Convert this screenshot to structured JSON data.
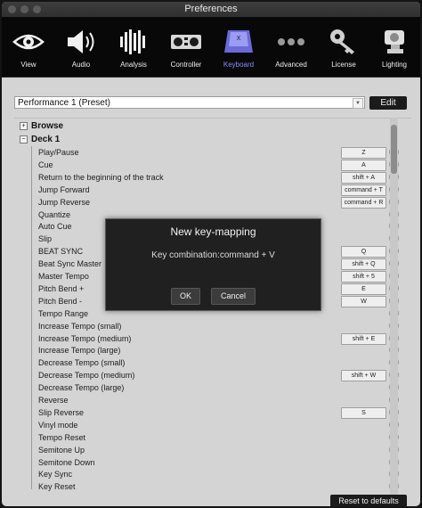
{
  "window": {
    "title": "Preferences"
  },
  "toolbar": [
    {
      "label": "View",
      "icon": "eye-icon"
    },
    {
      "label": "Audio",
      "icon": "speaker-icon"
    },
    {
      "label": "Analysis",
      "icon": "waveform-icon"
    },
    {
      "label": "Controller",
      "icon": "controller-icon"
    },
    {
      "label": "Keyboard",
      "icon": "keyboard-key-icon",
      "selected": true
    },
    {
      "label": "Advanced",
      "icon": "dots-icon"
    },
    {
      "label": "License",
      "icon": "key-icon"
    },
    {
      "label": "Lighting",
      "icon": "stage-light-icon"
    }
  ],
  "preset": {
    "value": "Performance 1 (Preset)",
    "edit_label": "Edit"
  },
  "tree": {
    "browse": {
      "label": "Browse",
      "expander": "+"
    },
    "deck1": {
      "label": "Deck 1",
      "expander": "−"
    },
    "rows": [
      {
        "label": "Play/Pause",
        "key": "Z"
      },
      {
        "label": "Cue",
        "key": "A"
      },
      {
        "label": "Return to the beginning of the track",
        "key": "shift + A"
      },
      {
        "label": "Jump Forward",
        "key": "command + T"
      },
      {
        "label": "Jump Reverse",
        "key": "command + R"
      },
      {
        "label": "Quantize",
        "key": ""
      },
      {
        "label": "Auto Cue",
        "key": ""
      },
      {
        "label": "Slip",
        "key": ""
      },
      {
        "label": "BEAT SYNC",
        "key": "Q"
      },
      {
        "label": "Beat Sync Master",
        "key": "shift + Q"
      },
      {
        "label": "Master Tempo",
        "key": "shift + 5"
      },
      {
        "label": "Pitch Bend +",
        "key": "E"
      },
      {
        "label": "Pitch Bend -",
        "key": "W"
      },
      {
        "label": "Tempo Range",
        "key": ""
      },
      {
        "label": "Increase Tempo (small)",
        "key": ""
      },
      {
        "label": "Increase Tempo (medium)",
        "key": "shift + E"
      },
      {
        "label": "Increase Tempo (large)",
        "key": ""
      },
      {
        "label": "Decrease Tempo (small)",
        "key": ""
      },
      {
        "label": "Decrease Tempo (medium)",
        "key": "shift + W"
      },
      {
        "label": "Decrease Tempo (large)",
        "key": ""
      },
      {
        "label": "Reverse",
        "key": ""
      },
      {
        "label": "Slip Reverse",
        "key": "S"
      },
      {
        "label": "Vinyl mode",
        "key": ""
      },
      {
        "label": "Tempo Reset",
        "key": ""
      },
      {
        "label": "Semitone Up",
        "key": ""
      },
      {
        "label": "Semitone Down",
        "key": ""
      },
      {
        "label": "Key Sync",
        "key": ""
      },
      {
        "label": "Key Reset",
        "key": ""
      }
    ],
    "add_symbol": "+"
  },
  "footer": {
    "reset_label": "Reset to defaults"
  },
  "modal": {
    "title": "New key-mapping",
    "message": "Key combination:command + V",
    "ok_label": "OK",
    "cancel_label": "Cancel"
  },
  "colors": {
    "selected_tab": "#8a8aff",
    "toolbar_bg": "#080808",
    "panel_bg": "#d4d4d4"
  }
}
